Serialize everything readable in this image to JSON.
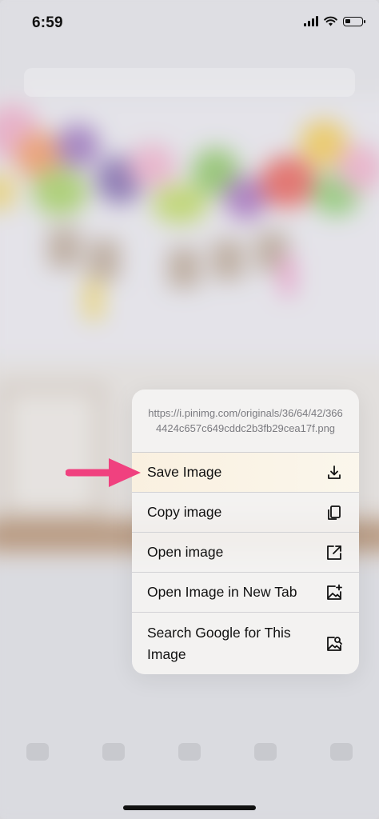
{
  "status_bar": {
    "time": "6:59"
  },
  "context_menu": {
    "url": "https://i.pinimg.com/originals/36/64/42/3664424c657c649cddc2b3fb29cea17f.png",
    "items": [
      {
        "label": "Save Image",
        "icon": "download-icon",
        "highlighted": true
      },
      {
        "label": "Copy image",
        "icon": "copy-icon"
      },
      {
        "label": "Open image",
        "icon": "open-external-icon"
      },
      {
        "label": "Open Image in New Tab",
        "icon": "new-tab-image-icon"
      },
      {
        "label": "Search Google for This Image",
        "icon": "image-search-icon"
      }
    ]
  },
  "annotation": {
    "arrow_color": "#f0417f"
  }
}
